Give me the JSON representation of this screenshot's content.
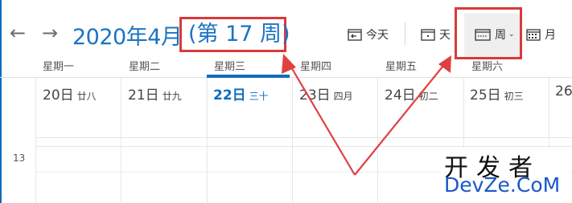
{
  "header": {
    "title": "2020年4月",
    "week_number": "(第 17 周)"
  },
  "toolbar": {
    "today_label": "今天",
    "day_label": "天",
    "week_label": "周",
    "month_label": "月",
    "highlight_color": "#d83a3a"
  },
  "weekdays": [
    "星期一",
    "星期二",
    "星期三",
    "星期四",
    "星期五",
    "星期六"
  ],
  "dates": [
    {
      "day": "20日",
      "lunar": "廿八"
    },
    {
      "day": "21日",
      "lunar": "廿九"
    },
    {
      "day": "22日",
      "lunar": "三十"
    },
    {
      "day": "23日",
      "lunar": "四月"
    },
    {
      "day": "24日",
      "lunar": "初二"
    },
    {
      "day": "25日",
      "lunar": "初三"
    },
    {
      "day": "26",
      "lunar": ""
    }
  ],
  "hours": [
    "13"
  ],
  "watermark": {
    "cn": "开发者",
    "en": "DevZe.CoM"
  },
  "colors": {
    "accent": "#0f6cbd",
    "title": "#1a73c4",
    "annotation": "#d83a3a"
  }
}
